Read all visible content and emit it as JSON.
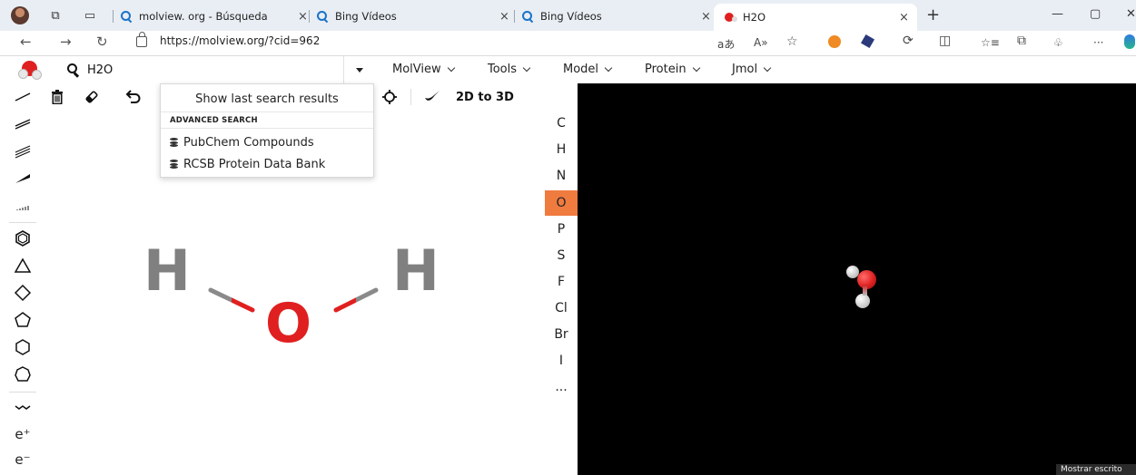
{
  "browser": {
    "tabs": [
      {
        "title": "molview. org - Búsqueda",
        "icon": "search-icon",
        "active": false
      },
      {
        "title": "Bing Vídeos",
        "icon": "search-icon",
        "active": false
      },
      {
        "title": "Bing Vídeos",
        "icon": "search-icon",
        "active": false
      },
      {
        "title": "H2O",
        "icon": "molview-favicon",
        "active": true
      }
    ],
    "close_glyph": "×",
    "new_tab_glyph": "+",
    "url": "https://molview.org/?cid=962",
    "window_controls": [
      "—",
      "▢",
      "✕"
    ]
  },
  "app": {
    "search": {
      "value": "H2O",
      "placeholder": ""
    },
    "menus": [
      "MolView",
      "Tools",
      "Model",
      "Protein",
      "Jmol"
    ],
    "toolbar": {
      "to3d_label": "2D to 3D"
    },
    "dropdown": {
      "last_results": "Show last search results",
      "advanced_heading": "ADVANCED SEARCH",
      "pubchem": "PubChem Compounds",
      "rcsb": "RCSB Protein Data Bank"
    },
    "elements": [
      "C",
      "H",
      "N",
      "O",
      "P",
      "S",
      "F",
      "Cl",
      "Br",
      "I",
      "..."
    ],
    "active_element": "O",
    "charge_plus": "e⁺",
    "charge_minus": "e⁻",
    "molecule2d": {
      "left": "H",
      "center": "O",
      "right": "H"
    },
    "tooltip": "Mostrar escrito"
  },
  "colors": {
    "accent": "#f07b3f",
    "oxygen": "#e02020",
    "hydrogen": "#808080",
    "viewer_bg": "#000000"
  }
}
